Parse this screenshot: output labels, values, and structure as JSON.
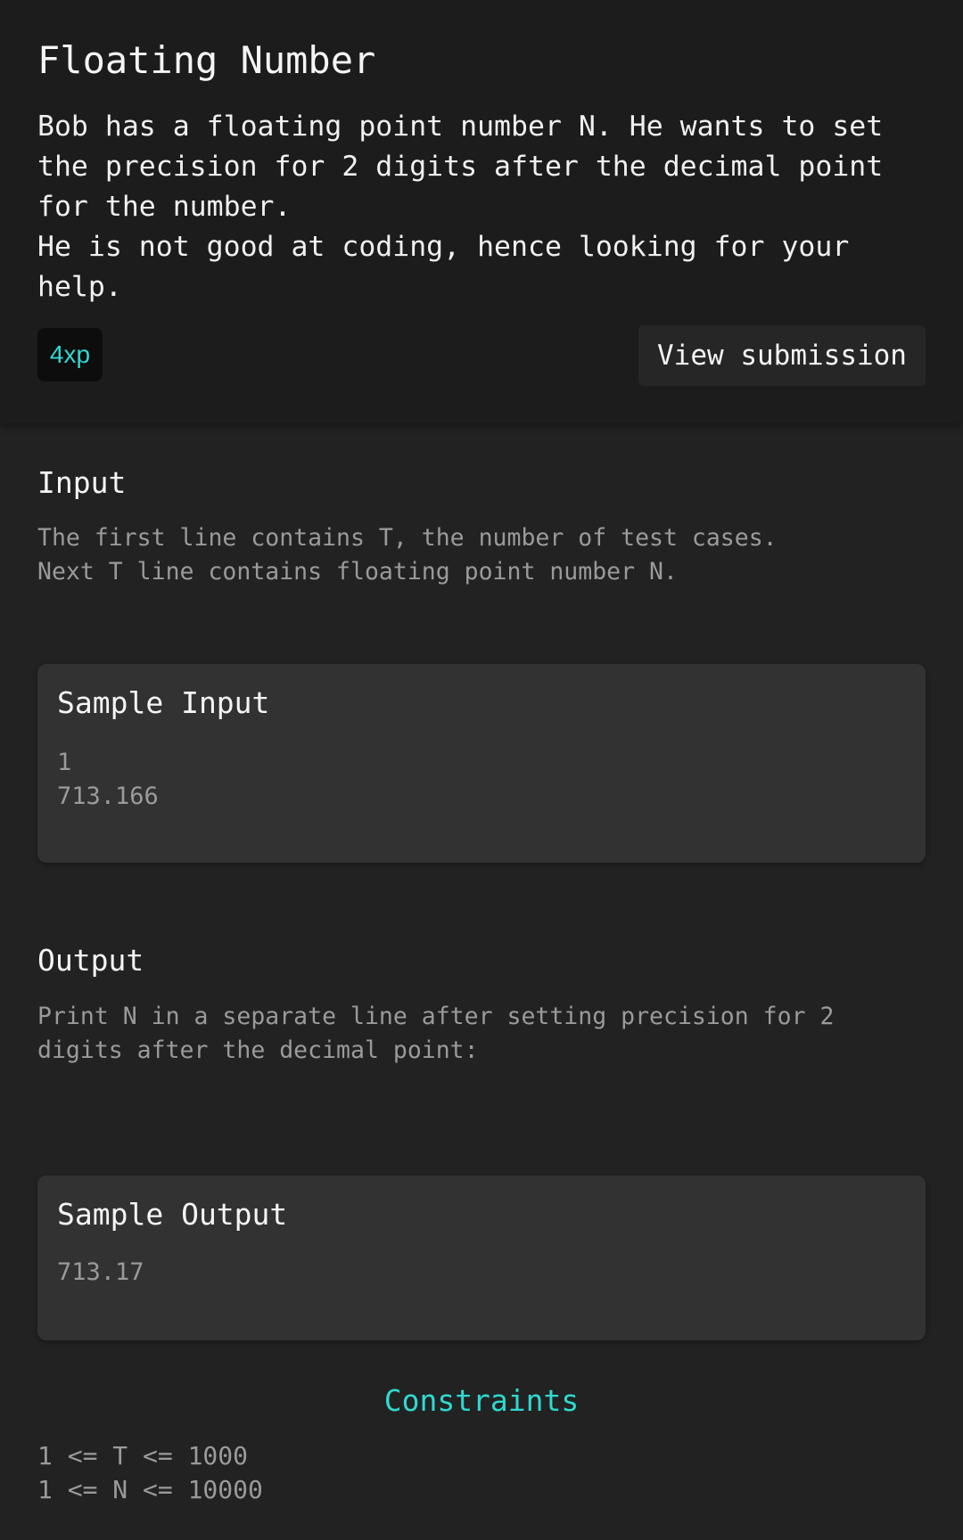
{
  "problem": {
    "title": "Floating Number",
    "description": "Bob has a floating point number N. He wants to set the precision for 2 digits after the decimal point for the number.\nHe is not good at coding, hence looking for your help.",
    "xp": "4xp",
    "view_submission_label": "View submission"
  },
  "input_section": {
    "title": "Input",
    "text": "The first line contains T, the number of test cases.\nNext T line contains floating point number N."
  },
  "sample_input": {
    "title": "Sample Input",
    "body": "1\n713.166"
  },
  "output_section": {
    "title": "Output",
    "text": "Print N in a separate line after setting precision for 2\ndigits after the decimal point:"
  },
  "sample_output": {
    "title": "Sample Output",
    "body": "713.17"
  },
  "constraints": {
    "title": "Constraints",
    "text": "1 <= T <= 1000\n1 <= N <= 10000"
  },
  "colors": {
    "accent": "#2fd9d0",
    "background": "#222222",
    "header_background": "#1c1c1c",
    "card_background": "#323232"
  }
}
